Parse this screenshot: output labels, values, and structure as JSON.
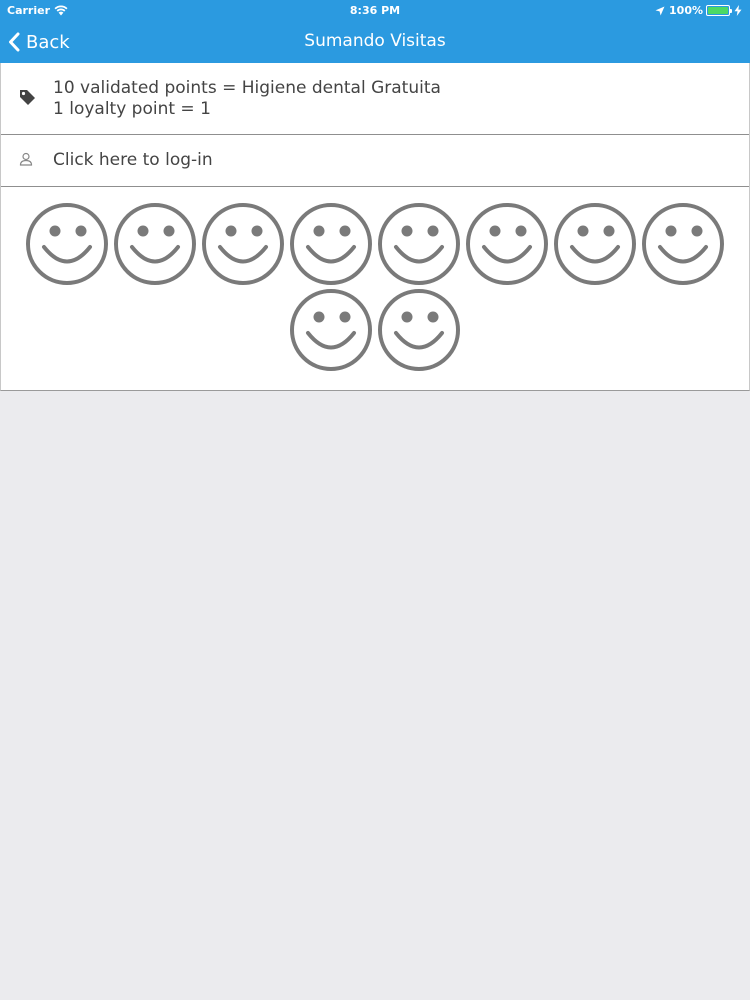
{
  "status_bar": {
    "carrier": "Carrier",
    "time": "8:36 PM",
    "battery_percent": "100%",
    "battery_level": 1.0
  },
  "nav": {
    "back_label": "Back",
    "title": "Sumando Visitas"
  },
  "info": {
    "line1": "10 validated points = Higiene dental Gratuita",
    "line2": "1 loyalty point = 1",
    "icon": "tag-icon"
  },
  "login": {
    "label": "Click here to log-in",
    "icon": "user-icon"
  },
  "points": {
    "total": 10,
    "icon": "smiley-icon"
  },
  "colors": {
    "nav_bar": "#2b9ae0",
    "background": "#ebebee",
    "smiley": "#7a7a7a",
    "text": "#444444",
    "battery": "#4cd964"
  }
}
